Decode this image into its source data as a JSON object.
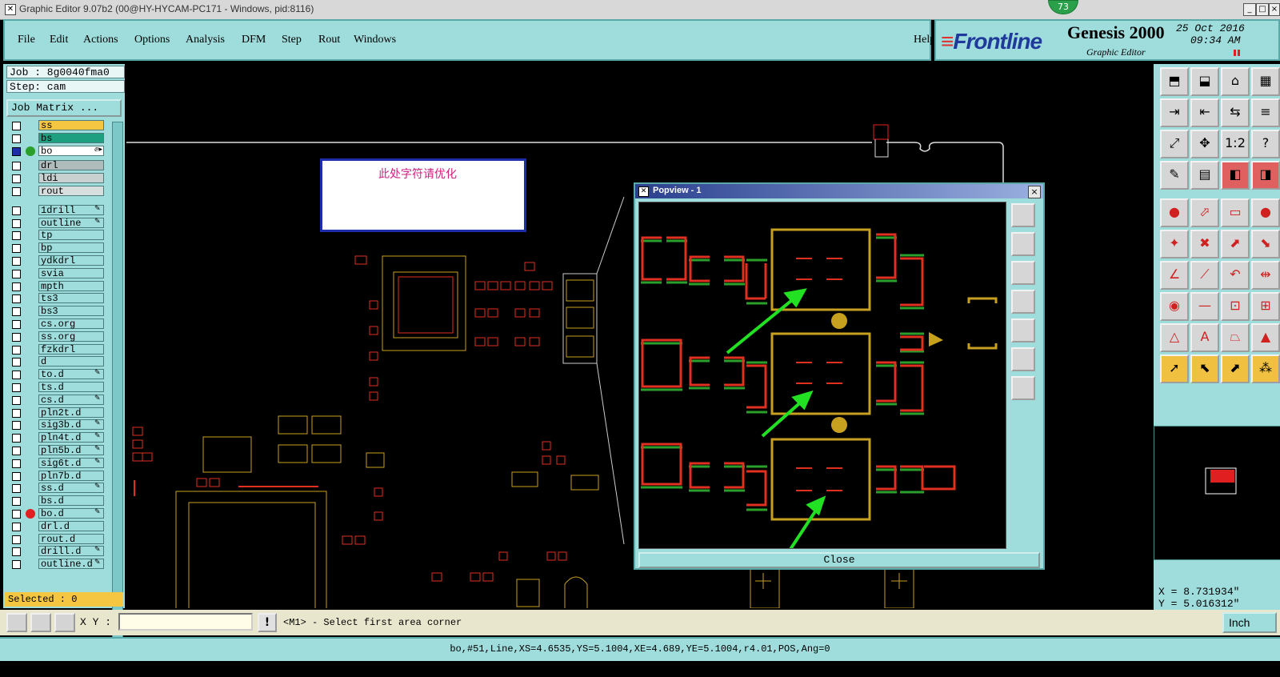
{
  "window": {
    "title": "Graphic Editor 9.07b2 (00@HY-HYCAM-PC171 - Windows, pid:8116)",
    "badge": "73",
    "min_label": "_",
    "max_label": "□",
    "close_label": "×"
  },
  "menu": [
    "File",
    "Edit",
    "Actions",
    "Options",
    "Analysis",
    "DFM",
    "Step",
    "Rout",
    "Windows"
  ],
  "help_label": "Help",
  "brand": {
    "logo": "Frontline",
    "product": "Genesis 2000",
    "subtitle": "Graphic Editor",
    "date": "25 Oct 2016",
    "time": "09:34 AM"
  },
  "job": {
    "job_line": "Job : 8g0040fma0",
    "step_line": "Step: cam",
    "matrix_label": "Job Matrix ..."
  },
  "layers": [
    {
      "name": "ss",
      "color": "#f4c642",
      "active": false,
      "dot": "",
      "mark": ""
    },
    {
      "name": "bs",
      "color": "#1ea080",
      "active": false,
      "dot": "",
      "mark": ""
    },
    {
      "name": "bo",
      "color": "#ffffff",
      "active": true,
      "dot": "#2aa02a",
      "mark": "ⅇ▸"
    },
    {
      "name": "drl",
      "color": "#b0bcbc",
      "active": false,
      "dot": "",
      "mark": ""
    },
    {
      "name": "ldi",
      "color": "#c8d0d0",
      "active": false,
      "dot": "",
      "mark": ""
    },
    {
      "name": "rout",
      "color": "#d8dede",
      "active": false,
      "dot": "",
      "mark": ""
    },
    {
      "name": "1drill",
      "color": "",
      "active": false,
      "dot": "",
      "mark": "✎"
    },
    {
      "name": "outline",
      "color": "",
      "active": false,
      "dot": "",
      "mark": "✎"
    },
    {
      "name": "tp",
      "color": "",
      "active": false,
      "dot": "",
      "mark": ""
    },
    {
      "name": "bp",
      "color": "",
      "active": false,
      "dot": "",
      "mark": ""
    },
    {
      "name": "ydkdrl",
      "color": "",
      "active": false,
      "dot": "",
      "mark": ""
    },
    {
      "name": "svia",
      "color": "",
      "active": false,
      "dot": "",
      "mark": ""
    },
    {
      "name": "mpth",
      "color": "",
      "active": false,
      "dot": "",
      "mark": ""
    },
    {
      "name": "ts3",
      "color": "",
      "active": false,
      "dot": "",
      "mark": ""
    },
    {
      "name": "bs3",
      "color": "",
      "active": false,
      "dot": "",
      "mark": ""
    },
    {
      "name": "cs.org",
      "color": "",
      "active": false,
      "dot": "",
      "mark": ""
    },
    {
      "name": "ss.org",
      "color": "",
      "active": false,
      "dot": "",
      "mark": ""
    },
    {
      "name": "fzkdrl",
      "color": "",
      "active": false,
      "dot": "",
      "mark": ""
    },
    {
      "name": "d",
      "color": "",
      "active": false,
      "dot": "",
      "mark": ""
    },
    {
      "name": "to.d",
      "color": "",
      "active": false,
      "dot": "",
      "mark": "✎"
    },
    {
      "name": "ts.d",
      "color": "",
      "active": false,
      "dot": "",
      "mark": ""
    },
    {
      "name": "cs.d",
      "color": "",
      "active": false,
      "dot": "",
      "mark": "✎"
    },
    {
      "name": "pln2t.d",
      "color": "",
      "active": false,
      "dot": "",
      "mark": ""
    },
    {
      "name": "sig3b.d",
      "color": "",
      "active": false,
      "dot": "",
      "mark": "✎"
    },
    {
      "name": "pln4t.d",
      "color": "",
      "active": false,
      "dot": "",
      "mark": "✎"
    },
    {
      "name": "pln5b.d",
      "color": "",
      "active": false,
      "dot": "",
      "mark": "✎"
    },
    {
      "name": "sig6t.d",
      "color": "",
      "active": false,
      "dot": "",
      "mark": "✎"
    },
    {
      "name": "pln7b.d",
      "color": "",
      "active": false,
      "dot": "",
      "mark": ""
    },
    {
      "name": "ss.d",
      "color": "",
      "active": false,
      "dot": "",
      "mark": "✎"
    },
    {
      "name": "bs.d",
      "color": "",
      "active": false,
      "dot": "",
      "mark": ""
    },
    {
      "name": "bo.d",
      "color": "",
      "active": false,
      "dot": "#e02020",
      "mark": "✎"
    },
    {
      "name": "drl.d",
      "color": "",
      "active": false,
      "dot": "",
      "mark": ""
    },
    {
      "name": "rout.d",
      "color": "",
      "active": false,
      "dot": "",
      "mark": ""
    },
    {
      "name": "drill.d",
      "color": "",
      "active": false,
      "dot": "",
      "mark": "✎"
    },
    {
      "name": "outline.d",
      "color": "",
      "active": false,
      "dot": "",
      "mark": "✎"
    }
  ],
  "selected": "Selected : 0",
  "cmd": {
    "xy_label": "X Y :",
    "xy_value": "",
    "warn": "!",
    "prompt": "<M1> - Select first area corner",
    "unit": "Inch"
  },
  "status": "bo,#51,Line,XS=4.6535,YS=5.1004,XE=4.689,YE=5.1004,r4.01,POS,Ang=0",
  "coords": {
    "x": "X = 8.731934\"",
    "y": "Y = 5.016312\""
  },
  "canvas_note": "此处字符请优化",
  "popview": {
    "title": "Popview - 1",
    "close_label": "Close",
    "close_x": "×"
  },
  "colors": {
    "panel": "#9fdcdc",
    "pad_red": "#e03020",
    "pad_green": "#2aa02a",
    "outline_gold": "#c8a020",
    "arrow": "#22e022"
  }
}
